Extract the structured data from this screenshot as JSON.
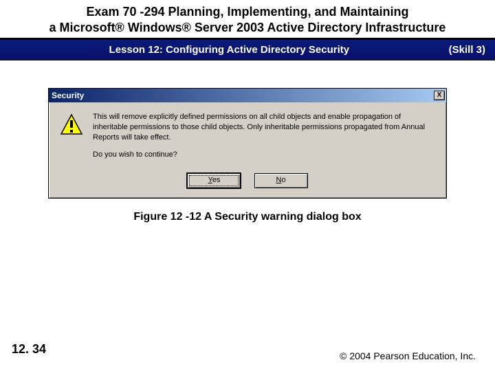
{
  "header": {
    "title_line1": "Exam 70 -294 Planning, Implementing, and Maintaining",
    "title_line2": "a Microsoft® Windows® Server 2003 Active Directory Infrastructure"
  },
  "subheader": {
    "lesson": "Lesson 12: Configuring Active Directory Security",
    "skill": "(Skill 3)"
  },
  "dialog": {
    "title": "Security",
    "message": "This will remove explicitly defined permissions on all child objects and enable propagation of inheritable permissions to those child objects. Only inheritable permissions propagated from Annual Reports will take effect.",
    "prompt": "Do you wish to continue?",
    "yes_hotkey": "Y",
    "yes_rest": "es",
    "no_hotkey": "N",
    "no_rest": "o",
    "close_label": "X"
  },
  "caption": "Figure 12 -12 A Security warning dialog box",
  "footer": {
    "page": "12. 34",
    "copyright": "© 2004 Pearson Education, Inc."
  }
}
